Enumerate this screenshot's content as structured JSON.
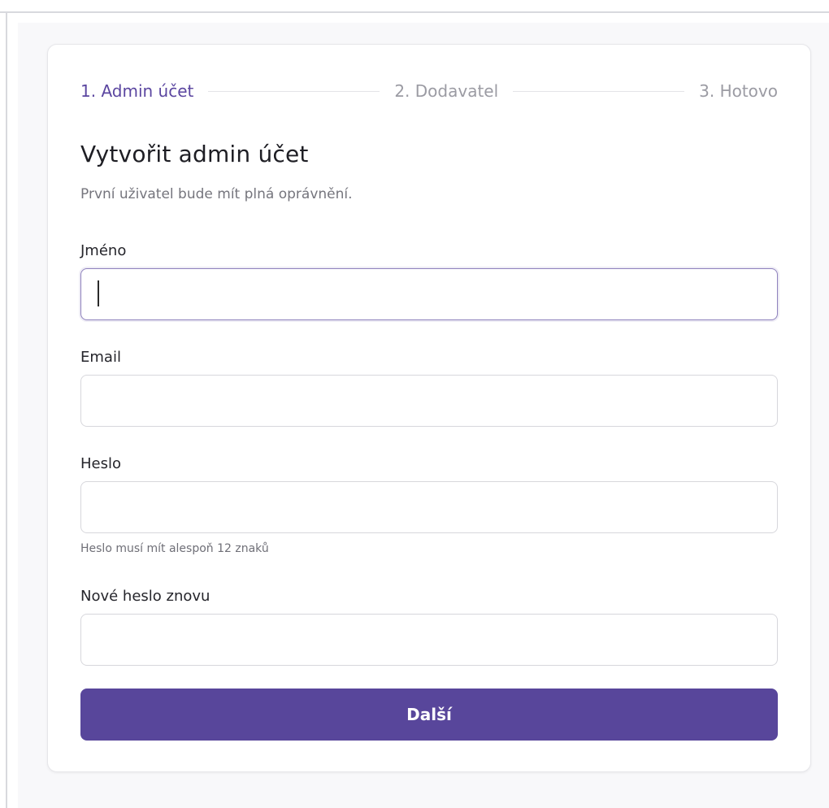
{
  "stepper": {
    "steps": [
      {
        "label": "1. Admin účet",
        "state": "active"
      },
      {
        "label": "2. Dodavatel",
        "state": "inactive"
      },
      {
        "label": "3. Hotovo",
        "state": "inactive"
      }
    ]
  },
  "form": {
    "title": "Vytvořit admin účet",
    "subtitle": "První uživatel bude mít plná oprávnění.",
    "fields": [
      {
        "label": "Jméno",
        "value": "",
        "placeholder": "",
        "focused": true
      },
      {
        "label": "Email",
        "value": "",
        "placeholder": ""
      },
      {
        "label": "Heslo",
        "value": "",
        "placeholder": "",
        "hint": "Heslo musí mít alespoň 12 znaků"
      },
      {
        "label": "Nové heslo znovu",
        "value": "",
        "placeholder": ""
      }
    ],
    "submit_label": "Další"
  },
  "colors": {
    "accent": "#58469b",
    "active_step": "#5b46a0",
    "inactive_step": "#9b9ba3",
    "page_background": "#f8f8fa"
  }
}
